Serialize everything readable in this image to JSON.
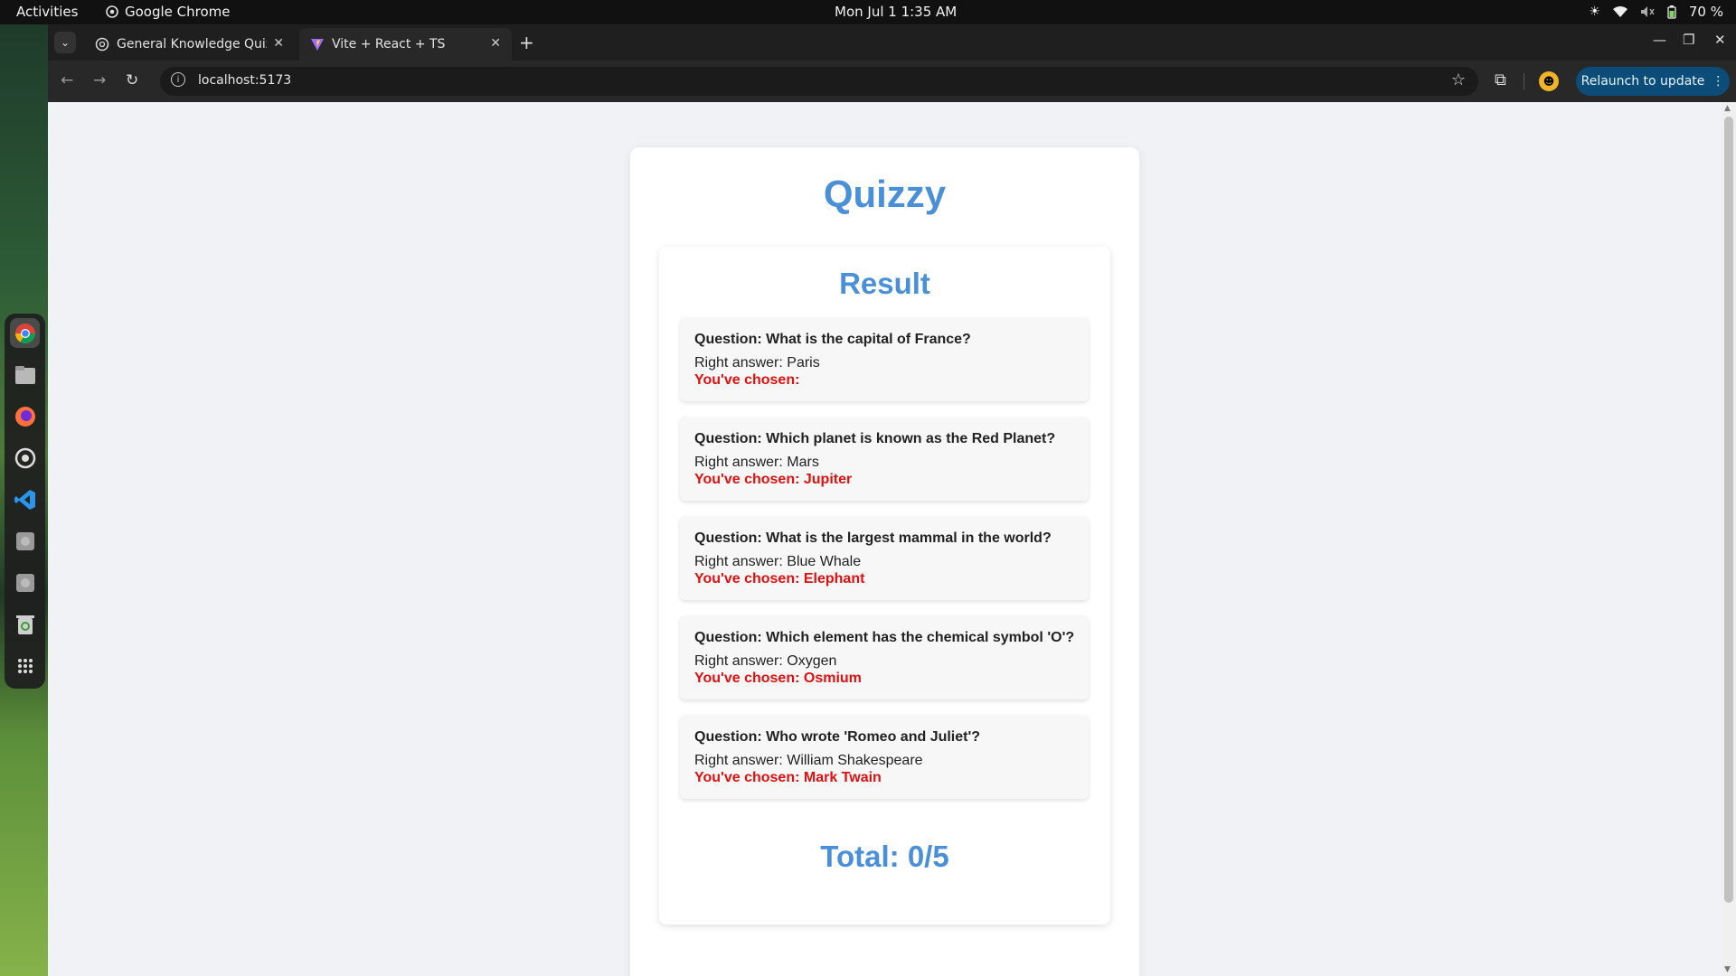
{
  "topbar": {
    "activities": "Activities",
    "app_name": "Google Chrome",
    "clock": "Mon Jul 1  1:35 AM",
    "battery": "70 %"
  },
  "dock": {
    "items": [
      "chrome-icon",
      "files-icon",
      "firefox-icon",
      "settings-icon",
      "vscode-icon",
      "disk-icon",
      "disk-icon",
      "trash-icon",
      "apps-grid-icon"
    ]
  },
  "browser": {
    "tabs": [
      {
        "label": "General Knowledge Quiz",
        "active": false
      },
      {
        "label": "Vite + React + TS",
        "active": true
      }
    ],
    "url": "localhost:5173",
    "relaunch_label": "Relaunch to update"
  },
  "quiz": {
    "app_title": "Quizzy",
    "result_title": "Result",
    "items": [
      {
        "question": "Question: What is the capital of France?",
        "right": "Right answer: Paris",
        "chosen": "You've chosen: "
      },
      {
        "question": "Question: Which planet is known as the Red Planet?",
        "right": "Right answer: Mars",
        "chosen": "You've chosen: Jupiter"
      },
      {
        "question": "Question: What is the largest mammal in the world?",
        "right": "Right answer: Blue Whale",
        "chosen": "You've chosen: Elephant"
      },
      {
        "question": "Question: Which element has the chemical symbol 'O'?",
        "right": "Right answer: Oxygen",
        "chosen": "You've chosen: Osmium"
      },
      {
        "question": "Question: Who wrote 'Romeo and Juliet'?",
        "right": "Right answer: William Shakespeare",
        "chosen": "You've chosen: Mark Twain"
      }
    ],
    "total": "Total: 0/5"
  },
  "colors": {
    "accent": "#4a90d9",
    "wrong": "#e01010",
    "relaunch_bg": "#0b4d78"
  }
}
